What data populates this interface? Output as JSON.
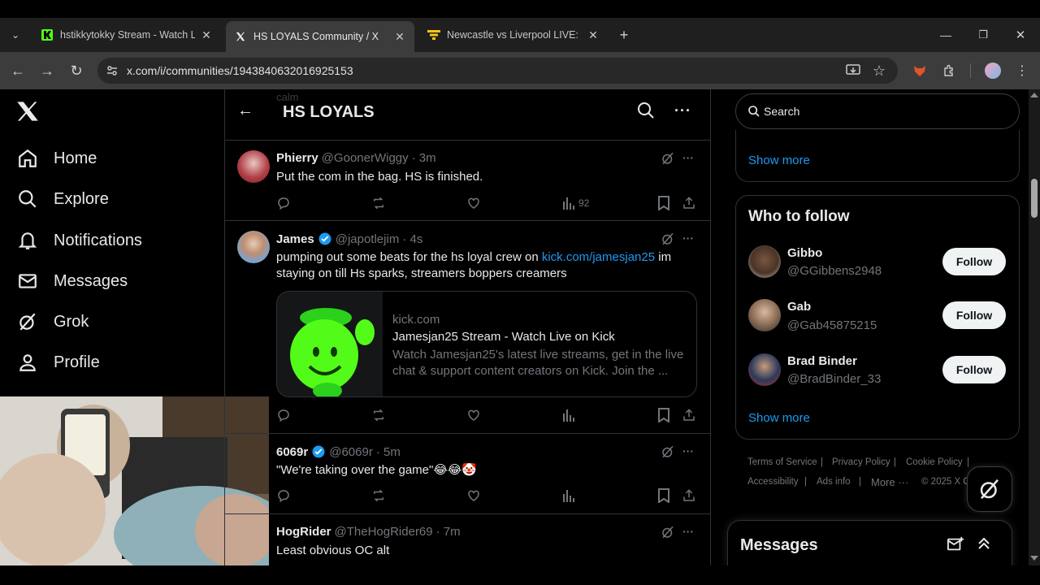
{
  "browser": {
    "tabs": [
      {
        "label": "hstikkytokky Stream - Watch Live",
        "icon": "kick-favicon",
        "color": "#53fc18"
      },
      {
        "label": "HS LOYALS Community / X",
        "icon": "x-favicon",
        "active": true
      },
      {
        "label": "Newcastle vs Liverpool LIVE: Pre",
        "icon": "sun-favicon",
        "color": "#f5c518"
      }
    ],
    "new_tab": "+",
    "url": "x.com/i/communities/1943840632016925153"
  },
  "nav": {
    "items": [
      {
        "label": "Home",
        "icon": "home-icon"
      },
      {
        "label": "Explore",
        "icon": "search-icon"
      },
      {
        "label": "Notifications",
        "icon": "bell-icon"
      },
      {
        "label": "Messages",
        "icon": "mail-icon"
      },
      {
        "label": "Grok",
        "icon": "grok-icon"
      },
      {
        "label": "Profile",
        "icon": "person-icon"
      }
    ]
  },
  "header": {
    "title": "HS LOYALS",
    "ghost_text": "calm"
  },
  "posts": [
    {
      "name": "Phierry",
      "handle": "@GoonerWiggy",
      "time": "· 3m",
      "text": "Put the com in the bag. HS is finished.",
      "views": "92"
    },
    {
      "name": "James",
      "handle": "@japotlejim",
      "time": "· 4s",
      "text_before": "pumping out some beats for the hs loyal crew on ",
      "link": "kick.com/jamesjan25",
      "text_after": " im staying on till Hs sparks, streamers boppers creamers",
      "card": {
        "domain": "kick.com",
        "title": "Jamesjan25 Stream - Watch Live on Kick",
        "desc": "Watch Jamesjan25's latest live streams, get in the live chat & support content creators on Kick. Join the ..."
      }
    },
    {
      "name": "6069r",
      "handle": "@6069r",
      "time": "· 5m",
      "text": "\"We're taking over the game\"😂😂🤡"
    },
    {
      "name": "HogRider",
      "handle": "@TheHogRider69",
      "time": "· 7m",
      "text": "Least obvious OC alt"
    }
  ],
  "right": {
    "search_placeholder": "Search",
    "show_more": "Show more",
    "who_to_follow": "Who to follow",
    "follow_label": "Follow",
    "suggestions": [
      {
        "name": "Gibbo",
        "handle": "@GGibbens2948"
      },
      {
        "name": "Gab",
        "handle": "@Gab45875215"
      },
      {
        "name": "Brad Binder",
        "handle": "@BradBinder_33"
      }
    ],
    "footer": [
      "Terms of Service",
      "Privacy Policy",
      "Cookie Policy",
      "Accessibility",
      "Ads info",
      "More ···",
      "© 2025 X C"
    ],
    "messages_title": "Messages"
  },
  "colors": {
    "accent": "#1d9bf0",
    "kick_green": "#53fc18"
  }
}
